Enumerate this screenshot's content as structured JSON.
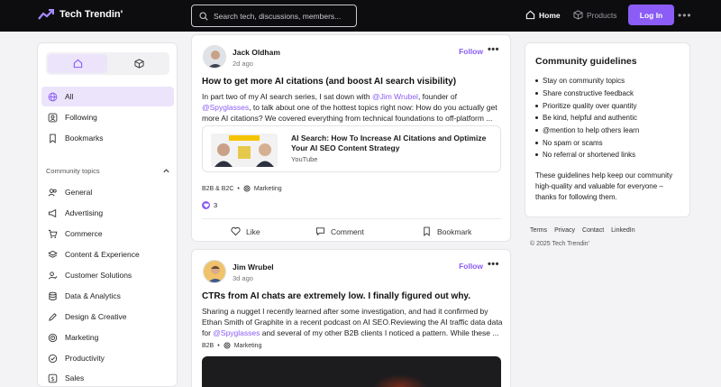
{
  "brand": {
    "name": "Tech Trendin'",
    "accent": "#8b5cf6"
  },
  "topbar": {
    "search_placeholder": "Search tech, discussions, members...",
    "nav_home": "Home",
    "nav_products": "Products",
    "login_label": "Log In",
    "more_label": "•••"
  },
  "sidebar": {
    "items": [
      {
        "label": "All",
        "icon": "globe-icon"
      },
      {
        "label": "Following",
        "icon": "user-square-icon"
      },
      {
        "label": "Bookmarks",
        "icon": "bookmark-icon"
      }
    ],
    "topics_heading": "Community topics",
    "topics": [
      {
        "label": "General",
        "icon": "users-icon"
      },
      {
        "label": "Advertising",
        "icon": "megaphone-icon"
      },
      {
        "label": "Commerce",
        "icon": "cart-icon"
      },
      {
        "label": "Content & Experience",
        "icon": "layers-icon"
      },
      {
        "label": "Customer Solutions",
        "icon": "user-check-icon"
      },
      {
        "label": "Data & Analytics",
        "icon": "database-icon"
      },
      {
        "label": "Design & Creative",
        "icon": "pen-icon"
      },
      {
        "label": "Marketing",
        "icon": "target-icon"
      },
      {
        "label": "Productivity",
        "icon": "check-circle-icon"
      },
      {
        "label": "Sales",
        "icon": "dollar-icon"
      }
    ]
  },
  "posts": [
    {
      "author": "Jack Oldham",
      "ago": "2d ago",
      "follow": "Follow",
      "title": "How to get more AI citations (and boost AI search visibility)",
      "body_1": "In part two of my AI search series, I sat down with ",
      "mention_1": "@Jim Wrubel",
      "body_2": ", founder of ",
      "mention_2": "@Spyglasses",
      "body_3": ", to talk about one of the hottest topics right now: How do you actually get more AI citations? We covered everything from technical foundations to off-platform ...",
      "link_title": "AI Search: How To Increase AI Citations and Optimize Your AI SEO Content Strategy",
      "link_source": "YouTube",
      "tag_1": "B2B & B2C",
      "tag_sep": "•",
      "tag_2": "Marketing",
      "reactions": "3",
      "like": "Like",
      "comment": "Comment",
      "bookmark": "Bookmark"
    },
    {
      "author": "Jim Wrubel",
      "ago": "3d ago",
      "follow": "Follow",
      "title": "CTRs from AI chats are extremely low. I finally figured out why.",
      "body_1": "Sharing a nugget I recently learned after some investigation, and had it confirmed by Ethan Smith of Graphite in a recent podcast on AI SEO.Reviewing the AI traffic data data for ",
      "mention_1": "@Spyglasses",
      "body_2": " and several of my other B2B clients I noticed a pattern. While these ...",
      "tag_1": "B2B",
      "tag_sep": "•",
      "tag_2": "Marketing"
    }
  ],
  "guidelines": {
    "title": "Community guidelines",
    "items": [
      "Stay on community topics",
      "Share constructive feedback",
      "Prioritize quality over quantity",
      "Be kind, helpful and authentic",
      "@mention to help others learn",
      "No spam or scams",
      "No referral or shortened links"
    ],
    "footer": "These guidelines help keep our community high-quality and valuable for everyone – thanks for following them."
  },
  "footer": {
    "links": [
      "Terms",
      "Privacy",
      "Contact",
      "LinkedIn"
    ],
    "copyright": "© 2025 Tech Trendin'"
  }
}
